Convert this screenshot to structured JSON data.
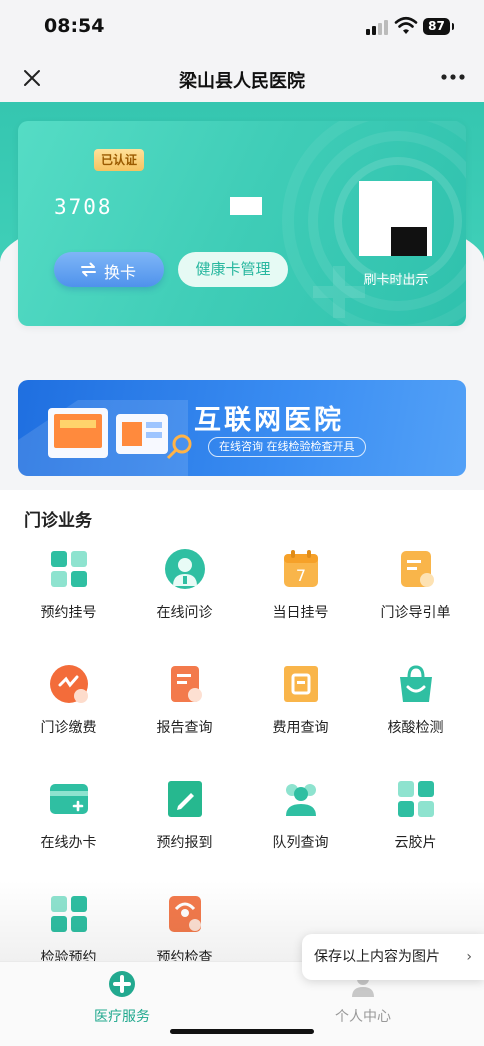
{
  "status_bar": {
    "time": "08:54",
    "battery": "87"
  },
  "nav": {
    "title": "梁山县人民医院"
  },
  "card": {
    "badge": "已认证",
    "number": "3708",
    "switch_label": "换卡",
    "manage_label": "健康卡管理",
    "qr_caption": "刷卡时出示"
  },
  "banner": {
    "title": "互联网医院",
    "subtitle": "在线咨询 在线检验检查开具"
  },
  "section": {
    "title": "门诊业务",
    "items": [
      {
        "label": "预约挂号",
        "icon": "appointment-grid-icon"
      },
      {
        "label": "在线问诊",
        "icon": "doctor-icon"
      },
      {
        "label": "当日挂号",
        "icon": "calendar-icon"
      },
      {
        "label": "门诊导引单",
        "icon": "guide-doc-icon"
      },
      {
        "label": "门诊缴费",
        "icon": "payment-icon"
      },
      {
        "label": "报告查询",
        "icon": "report-icon"
      },
      {
        "label": "费用查询",
        "icon": "fee-icon"
      },
      {
        "label": "核酸检测",
        "icon": "test-bag-icon"
      },
      {
        "label": "在线办卡",
        "icon": "card-add-icon"
      },
      {
        "label": "预约报到",
        "icon": "checkin-icon"
      },
      {
        "label": "队列查询",
        "icon": "queue-icon"
      },
      {
        "label": "云胶片",
        "icon": "cloud-film-icon"
      },
      {
        "label": "检验预约",
        "icon": "lab-grid-icon"
      },
      {
        "label": "预约检查",
        "icon": "ultrasound-icon"
      }
    ]
  },
  "tabs": [
    {
      "label": "医疗服务",
      "active": true
    },
    {
      "label": "个人中心",
      "active": false
    }
  ],
  "save_popup": {
    "label": "保存以上内容为图片",
    "chevron": "›"
  },
  "colors": {
    "primary": "#2fc1ad",
    "tab_active": "#22a98f",
    "banner": "#2a7fea"
  }
}
